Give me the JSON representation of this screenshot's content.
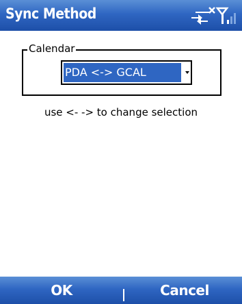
{
  "titlebar": {
    "title": "Sync Method",
    "icons": [
      "no-connection-icon",
      "signal-strength-icon"
    ]
  },
  "groupbox": {
    "legend": "Calendar",
    "combo": {
      "selected_value": "PDA <-> GCAL"
    }
  },
  "hint": "use <- -> to change selection",
  "softkeys": {
    "left_label": "OK",
    "right_label": "Cancel"
  },
  "colors": {
    "bar_blue": "#2f66c2",
    "selection_blue": "#2f66c2",
    "text": "#000000",
    "background": "#ffffff"
  }
}
